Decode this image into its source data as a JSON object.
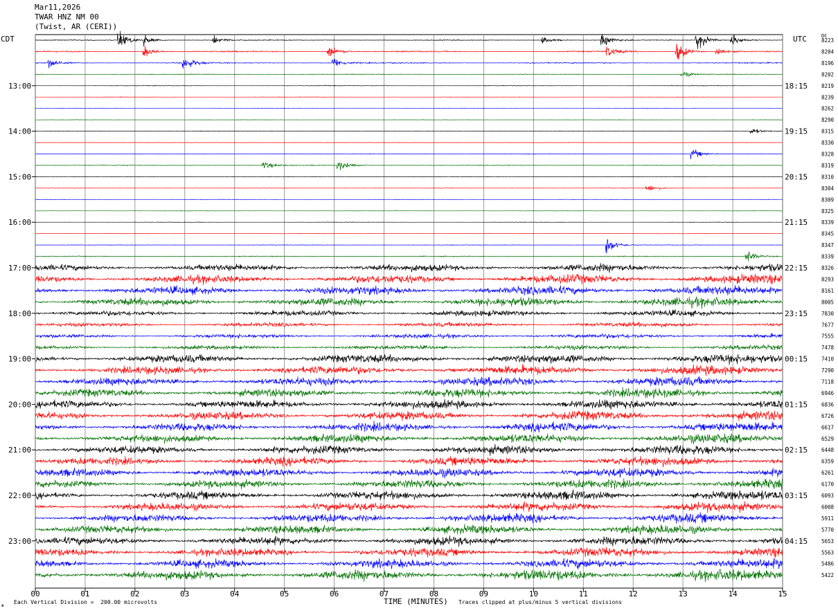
{
  "header": {
    "date": "Mar11,2026",
    "station": "TWAR HNZ NM 00",
    "location": "(Twist, AR (CERI))"
  },
  "timezones": {
    "left": "CDT",
    "right": "UTC"
  },
  "dc_label": "DC",
  "footer": {
    "scale_note": "Each Vertical Division =  200.00 microvolts",
    "clip_note": "Traces clipped at plus/minus 5 vertical divisions",
    "corner_mark": "ж"
  },
  "colors": {
    "trace_cycle": [
      "#000000",
      "#ff0000",
      "#0000ff",
      "#007000"
    ],
    "grid": "#808080",
    "background": "#ffffff"
  },
  "chart_data": {
    "type": "line",
    "title": "",
    "xlabel": "TIME (MINUTES)",
    "ylabel": "",
    "xlim": [
      0,
      15
    ],
    "x_ticks": [
      "00",
      "01",
      "02",
      "03",
      "04",
      "05",
      "06",
      "07",
      "08",
      "09",
      "10",
      "11",
      "12",
      "13",
      "14",
      "15"
    ],
    "row_minutes": 15,
    "left_time_labels": [
      {
        "row": 4,
        "label": "13:00"
      },
      {
        "row": 8,
        "label": "14:00"
      },
      {
        "row": 12,
        "label": "15:00"
      },
      {
        "row": 16,
        "label": "16:00"
      },
      {
        "row": 20,
        "label": "17:00"
      },
      {
        "row": 24,
        "label": "18:00"
      },
      {
        "row": 28,
        "label": "19:00"
      },
      {
        "row": 32,
        "label": "20:00"
      },
      {
        "row": 36,
        "label": "21:00"
      },
      {
        "row": 40,
        "label": "22:00"
      },
      {
        "row": 44,
        "label": "23:00"
      }
    ],
    "right_time_labels": [
      {
        "row": 4,
        "label": "18:15"
      },
      {
        "row": 8,
        "label": "19:15"
      },
      {
        "row": 12,
        "label": "20:15"
      },
      {
        "row": 16,
        "label": "21:15"
      },
      {
        "row": 20,
        "label": "22:15"
      },
      {
        "row": 24,
        "label": "23:15"
      },
      {
        "row": 28,
        "label": "00:15"
      },
      {
        "row": 32,
        "label": "01:15"
      },
      {
        "row": 36,
        "label": "02:15"
      },
      {
        "row": 40,
        "label": "03:15"
      },
      {
        "row": 44,
        "label": "04:15"
      }
    ],
    "dc_offsets": [
      "8223",
      "8204",
      "8196",
      "8202",
      "8219",
      "8239",
      "8262",
      "8290",
      "8315",
      "8330",
      "8328",
      "8319",
      "8310",
      "8304",
      "8309",
      "8325",
      "8339",
      "8345",
      "8347",
      "8339",
      "8326",
      "8293",
      "8161",
      "8005",
      "7830",
      "7677",
      "7555",
      "7478",
      "7410",
      "7290",
      "7118",
      "6946",
      "6836",
      "6726",
      "6617",
      "6529",
      "6448",
      "6359",
      "6261",
      "6170",
      "6093",
      "6008",
      "5911",
      "5770",
      "5653",
      "5563",
      "5486",
      "5422"
    ],
    "trace_noise_level": [
      0.6,
      0.9,
      0.8,
      0.5,
      0.4,
      0.3,
      0.3,
      0.3,
      0.3,
      0.3,
      0.4,
      0.5,
      0.3,
      0.3,
      0.3,
      0.3,
      0.3,
      0.3,
      0.4,
      0.6,
      5,
      6,
      6,
      6,
      4,
      3,
      3,
      3,
      6,
      6,
      6,
      6,
      6,
      6,
      6,
      6,
      6,
      6,
      6,
      6,
      6,
      6,
      6,
      6,
      6,
      6,
      6,
      7
    ],
    "events": [
      {
        "row": 0,
        "minute": 1.7,
        "amplitude": 10
      },
      {
        "row": 0,
        "minute": 2.2,
        "amplitude": 6
      },
      {
        "row": 0,
        "minute": 3.6,
        "amplitude": 5
      },
      {
        "row": 0,
        "minute": 10.2,
        "amplitude": 5
      },
      {
        "row": 0,
        "minute": 11.4,
        "amplitude": 8
      },
      {
        "row": 0,
        "minute": 13.3,
        "amplitude": 12
      },
      {
        "row": 0,
        "minute": 14.0,
        "amplitude": 8
      },
      {
        "row": 1,
        "minute": 2.2,
        "amplitude": 7
      },
      {
        "row": 1,
        "minute": 5.9,
        "amplitude": 9
      },
      {
        "row": 1,
        "minute": 11.5,
        "amplitude": 7
      },
      {
        "row": 1,
        "minute": 12.9,
        "amplitude": 12
      },
      {
        "row": 1,
        "minute": 13.7,
        "amplitude": 6
      },
      {
        "row": 2,
        "minute": 0.3,
        "amplitude": 6
      },
      {
        "row": 2,
        "minute": 3.0,
        "amplitude": 9
      },
      {
        "row": 2,
        "minute": 6.0,
        "amplitude": 7
      },
      {
        "row": 3,
        "minute": 13.0,
        "amplitude": 4
      },
      {
        "row": 8,
        "minute": 14.4,
        "amplitude": 4
      },
      {
        "row": 10,
        "minute": 13.2,
        "amplitude": 6
      },
      {
        "row": 11,
        "minute": 4.6,
        "amplitude": 5
      },
      {
        "row": 11,
        "minute": 6.1,
        "amplitude": 7
      },
      {
        "row": 13,
        "minute": 12.3,
        "amplitude": 5
      },
      {
        "row": 18,
        "minute": 11.5,
        "amplitude": 10
      },
      {
        "row": 19,
        "minute": 14.3,
        "amplitude": 8
      }
    ]
  }
}
